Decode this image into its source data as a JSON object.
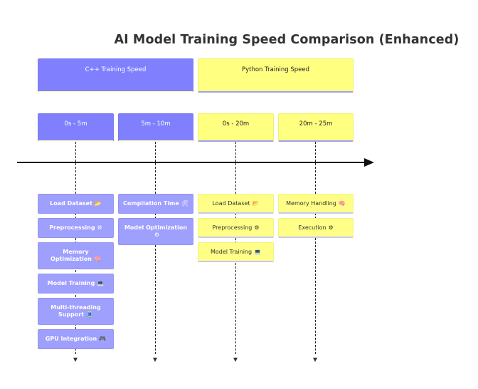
{
  "title": "AI Model Training Speed Comparison (Enhanced)",
  "sections": [
    {
      "label": "C++ Training Speed",
      "color": "#8080ff"
    },
    {
      "label": "Python Training Speed",
      "color": "#ffff80"
    }
  ],
  "periods": [
    {
      "label": "0s - 5m",
      "section": "C++ Training Speed",
      "events": [
        {
          "label": "Load Dataset",
          "icon": "📂",
          "icon_name": "folder-icon"
        },
        {
          "label": "Preprocessing",
          "icon": "⚙",
          "icon_name": "gear-icon"
        },
        {
          "label": "Memory Optimization",
          "icon": "🧠",
          "icon_name": "brain-icon"
        },
        {
          "label": "Model Training",
          "icon": "💻",
          "icon_name": "laptop-icon"
        },
        {
          "label": "Multi-threading Support",
          "icon": "🧵",
          "icon_name": "thread-icon"
        },
        {
          "label": "GPU Integration",
          "icon": "🎮",
          "icon_name": "gamepad-icon"
        }
      ]
    },
    {
      "label": "5m - 10m",
      "section": "C++ Training Speed",
      "events": [
        {
          "label": "Compilation Time",
          "icon": "🛠",
          "icon_name": "tools-icon"
        },
        {
          "label": "Model Optimization",
          "icon": "⚙",
          "icon_name": "gear-icon"
        }
      ]
    },
    {
      "label": "0s - 20m",
      "section": "Python Training Speed",
      "events": [
        {
          "label": "Load Dataset",
          "icon": "📂",
          "icon_name": "folder-icon"
        },
        {
          "label": "Preprocessing",
          "icon": "⚙",
          "icon_name": "gear-icon"
        },
        {
          "label": "Model Training",
          "icon": "💻",
          "icon_name": "computer-icon"
        }
      ]
    },
    {
      "label": "20m - 25m",
      "section": "Python Training Speed",
      "events": [
        {
          "label": "Memory Handling",
          "icon": "🧠",
          "icon_name": "brain-icon"
        },
        {
          "label": "Execution",
          "icon": "⚙",
          "icon_name": "gear-icon"
        }
      ]
    }
  ]
}
